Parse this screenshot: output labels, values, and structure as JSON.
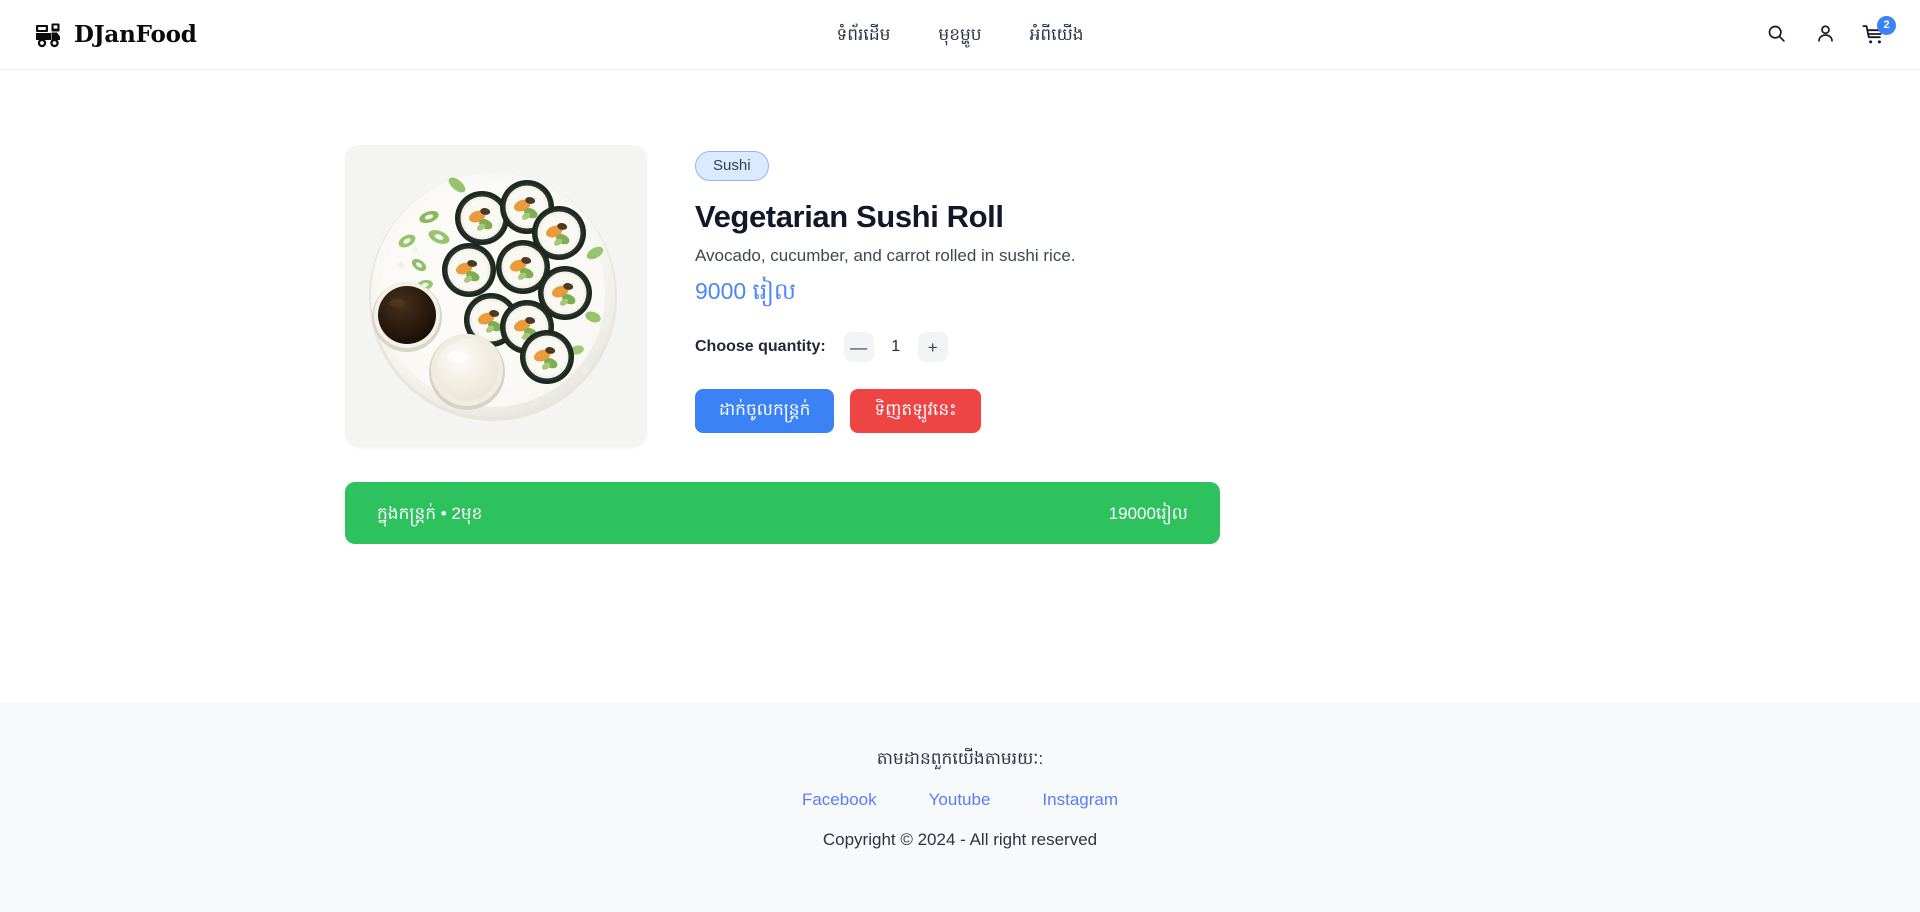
{
  "header": {
    "brand_name": "DJanFood",
    "brand_icon": "delivery-truck-icon",
    "nav": [
      {
        "label": "ទំព័រដើម"
      },
      {
        "label": "មុខម្ហូប"
      },
      {
        "label": "អំពីយើង"
      }
    ],
    "actions": {
      "search_icon": "search-icon",
      "account_icon": "user-icon",
      "cart_icon": "shopping-cart-icon",
      "cart_count": "2"
    }
  },
  "product": {
    "category": "Sushi",
    "title": "Vegetarian Sushi Roll",
    "description": "Avocado, cucumber, and carrot rolled in sushi rice.",
    "price": "9000 រៀល",
    "quantity_label": "Choose quantity:",
    "quantity_value": "1",
    "decrement_label": "—",
    "increment_label": "+",
    "add_to_cart_label": "ដាក់ចូលកន្ត្រក់",
    "buy_now_label": "ទិញតឡូវនេះ",
    "image_alt": "vegetarian-sushi-roll-plate"
  },
  "cart_summary": {
    "left_text": "ក្នុងកន្ត្រក់ • 2មុខ",
    "right_text": "19000រៀល"
  },
  "footer": {
    "heading": "តាមដានពួកយើងតាមរយៈ:",
    "links": [
      {
        "label": "Facebook"
      },
      {
        "label": "Youtube"
      },
      {
        "label": "Instagram"
      }
    ],
    "copyright": "Copyright © 2024 - All right reserved"
  },
  "colors": {
    "accent_blue": "#3b82f6",
    "price_blue": "#4d86f7",
    "danger_red": "#ef4444",
    "cart_green": "#2ec25e",
    "badge_bg": "#dbeafe",
    "footer_bg": "#f8f9fb",
    "link_blue": "#5b7cfa"
  }
}
